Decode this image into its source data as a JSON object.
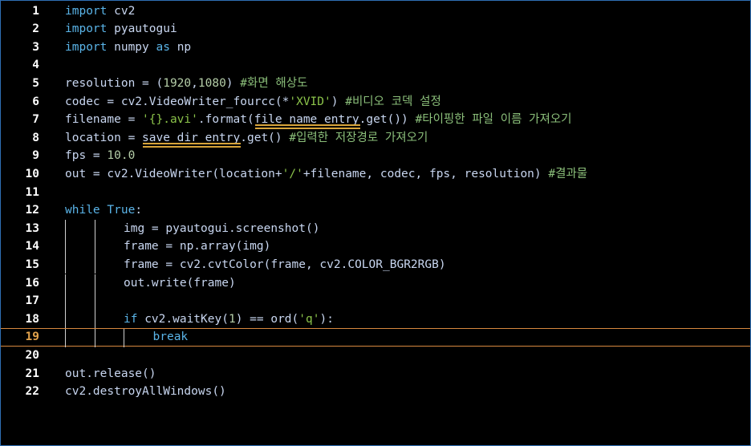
{
  "editor": {
    "active_line": "19",
    "lines": [
      {
        "n": "1",
        "tokens": [
          {
            "t": "import",
            "c": "k"
          },
          {
            "t": " cv2",
            "c": "t"
          }
        ]
      },
      {
        "n": "2",
        "tokens": [
          {
            "t": "import",
            "c": "k"
          },
          {
            "t": " pyautogui",
            "c": "t"
          }
        ]
      },
      {
        "n": "3",
        "tokens": [
          {
            "t": "import",
            "c": "k"
          },
          {
            "t": " numpy ",
            "c": "t"
          },
          {
            "t": "as",
            "c": "k"
          },
          {
            "t": " np",
            "c": "t"
          }
        ]
      },
      {
        "n": "4",
        "tokens": []
      },
      {
        "n": "5",
        "tokens": [
          {
            "t": "resolution = (",
            "c": "t"
          },
          {
            "t": "1920",
            "c": "n"
          },
          {
            "t": ",",
            "c": "t"
          },
          {
            "t": "1080",
            "c": "n"
          },
          {
            "t": ") ",
            "c": "t"
          },
          {
            "t": "#화면 해상도",
            "c": "c"
          }
        ]
      },
      {
        "n": "6",
        "tokens": [
          {
            "t": "codec = cv2.VideoWriter_fourcc(*",
            "c": "t"
          },
          {
            "t": "'XVID'",
            "c": "s"
          },
          {
            "t": ") ",
            "c": "t"
          },
          {
            "t": "#비디오 코덱 설정",
            "c": "c"
          }
        ]
      },
      {
        "n": "7",
        "tokens": [
          {
            "t": "filename = ",
            "c": "t"
          },
          {
            "t": "'{}.avi'",
            "c": "s"
          },
          {
            "t": ".format(",
            "c": "t"
          },
          {
            "t": "file_name_entry",
            "c": "t"
          },
          {
            "t": ".get()) ",
            "c": "t"
          },
          {
            "t": "#타이핑한 파일 이름 가져오기",
            "c": "c"
          }
        ]
      },
      {
        "n": "8",
        "tokens": [
          {
            "t": "location = ",
            "c": "t"
          },
          {
            "t": "save_dir_entry",
            "c": "t"
          },
          {
            "t": ".get() ",
            "c": "t"
          },
          {
            "t": "#입력한 저장경로 가져오기",
            "c": "c"
          }
        ]
      },
      {
        "n": "9",
        "tokens": [
          {
            "t": "fps = ",
            "c": "t"
          },
          {
            "t": "10.0",
            "c": "n"
          }
        ]
      },
      {
        "n": "10",
        "tokens": [
          {
            "t": "out = cv2.VideoWriter(location+",
            "c": "t"
          },
          {
            "t": "'/'",
            "c": "s"
          },
          {
            "t": "+filename, codec, fps, resolution) ",
            "c": "t"
          },
          {
            "t": "#결과물",
            "c": "c"
          }
        ]
      },
      {
        "n": "11",
        "tokens": []
      },
      {
        "n": "12",
        "tokens": [
          {
            "t": "while",
            "c": "k"
          },
          {
            "t": " ",
            "c": "t"
          },
          {
            "t": "True",
            "c": "k"
          },
          {
            "t": ":",
            "c": "t"
          }
        ]
      },
      {
        "n": "13",
        "indent": 2,
        "tokens": [
          {
            "t": "img = pyautogui.screenshot()",
            "c": "t"
          }
        ]
      },
      {
        "n": "14",
        "indent": 2,
        "tokens": [
          {
            "t": "frame = np.array(img)",
            "c": "t"
          }
        ]
      },
      {
        "n": "15",
        "indent": 2,
        "tokens": [
          {
            "t": "frame = cv2.cvtColor(frame, cv2.COLOR_BGR2RGB)",
            "c": "t"
          }
        ]
      },
      {
        "n": "16",
        "indent": 2,
        "tokens": [
          {
            "t": "out.write(frame)",
            "c": "t"
          }
        ]
      },
      {
        "n": "17",
        "indent": 2,
        "tokens": []
      },
      {
        "n": "18",
        "indent": 2,
        "tokens": [
          {
            "t": "if",
            "c": "k"
          },
          {
            "t": " cv2.waitKey(",
            "c": "t"
          },
          {
            "t": "1",
            "c": "n"
          },
          {
            "t": ") == ord(",
            "c": "t"
          },
          {
            "t": "'q'",
            "c": "s"
          },
          {
            "t": "):",
            "c": "t"
          }
        ]
      },
      {
        "n": "19",
        "indent": 3,
        "tokens": [
          {
            "t": "break",
            "c": "k"
          }
        ]
      },
      {
        "n": "20",
        "tokens": []
      },
      {
        "n": "21",
        "tokens": [
          {
            "t": "out.release()",
            "c": "t"
          }
        ]
      },
      {
        "n": "22",
        "tokens": [
          {
            "t": "cv2.destroyAllWindows()",
            "c": "t"
          }
        ]
      }
    ]
  },
  "colors": {
    "background": "#000000",
    "keyword": "#5ab4e8",
    "string": "#8bc34a",
    "comment": "#8bbf7a",
    "number": "#b5cea8",
    "active_line_border": "#d7883f",
    "underline": "#d7a43a"
  }
}
